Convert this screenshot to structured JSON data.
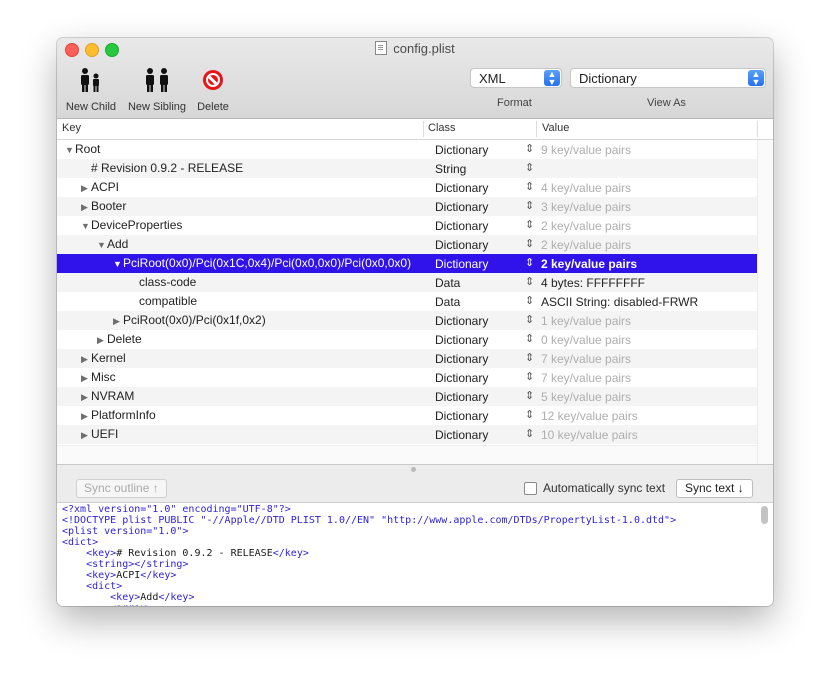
{
  "window": {
    "title": "config.plist"
  },
  "toolbar": {
    "new_child": "New Child",
    "new_sibling": "New Sibling",
    "delete": "Delete",
    "format": {
      "value": "XML",
      "label": "Format"
    },
    "view_as": {
      "value": "Dictionary",
      "label": "View As"
    }
  },
  "table": {
    "headers": {
      "key": "Key",
      "class": "Class",
      "value": "Value"
    },
    "rows": [
      {
        "indent": 0,
        "disclosure": "▼",
        "key": "Root",
        "class": "Dictionary",
        "value": "9 key/value pairs",
        "dim": true
      },
      {
        "indent": 1,
        "disclosure": "",
        "key": "# Revision 0.9.2 - RELEASE",
        "class": "String",
        "value": "",
        "dim": false
      },
      {
        "indent": 1,
        "disclosure": "▶",
        "key": "ACPI",
        "class": "Dictionary",
        "value": "4 key/value pairs",
        "dim": true
      },
      {
        "indent": 1,
        "disclosure": "▶",
        "key": "Booter",
        "class": "Dictionary",
        "value": "3 key/value pairs",
        "dim": true
      },
      {
        "indent": 1,
        "disclosure": "▼",
        "key": "DeviceProperties",
        "class": "Dictionary",
        "value": "2 key/value pairs",
        "dim": true
      },
      {
        "indent": 2,
        "disclosure": "▼",
        "key": "Add",
        "class": "Dictionary",
        "value": "2 key/value pairs",
        "dim": true
      },
      {
        "indent": 3,
        "disclosure": "▼",
        "key": "PciRoot(0x0)/Pci(0x1C,0x4)/Pci(0x0,0x0)/Pci(0x0,0x0)",
        "class": "Dictionary",
        "value": "2 key/value pairs",
        "dim": false,
        "selected": true
      },
      {
        "indent": 4,
        "disclosure": "",
        "key": "class-code",
        "class": "Data",
        "value": "4 bytes: FFFFFFFF",
        "dim": false
      },
      {
        "indent": 4,
        "disclosure": "",
        "key": "compatible",
        "class": "Data",
        "value": "ASCII String: disabled-FRWR",
        "dim": false
      },
      {
        "indent": 3,
        "disclosure": "▶",
        "key": "PciRoot(0x0)/Pci(0x1f,0x2)",
        "class": "Dictionary",
        "value": "1 key/value pairs",
        "dim": true
      },
      {
        "indent": 2,
        "disclosure": "▶",
        "key": "Delete",
        "class": "Dictionary",
        "value": "0 key/value pairs",
        "dim": true
      },
      {
        "indent": 1,
        "disclosure": "▶",
        "key": "Kernel",
        "class": "Dictionary",
        "value": "7 key/value pairs",
        "dim": true
      },
      {
        "indent": 1,
        "disclosure": "▶",
        "key": "Misc",
        "class": "Dictionary",
        "value": "7 key/value pairs",
        "dim": true
      },
      {
        "indent": 1,
        "disclosure": "▶",
        "key": "NVRAM",
        "class": "Dictionary",
        "value": "5 key/value pairs",
        "dim": true
      },
      {
        "indent": 1,
        "disclosure": "▶",
        "key": "PlatformInfo",
        "class": "Dictionary",
        "value": "12 key/value pairs",
        "dim": true
      },
      {
        "indent": 1,
        "disclosure": "▶",
        "key": "UEFI",
        "class": "Dictionary",
        "value": "10 key/value pairs",
        "dim": true
      }
    ]
  },
  "sync_bar": {
    "sync_outline": "Sync outline ↑",
    "auto_sync": "Automatically sync text",
    "sync_text": "Sync text ↓"
  },
  "xml_text": {
    "lines": [
      [
        {
          "c": "pi",
          "s": "<?xml version=\"1.0\" encoding=\"UTF-8\"?>"
        }
      ],
      [
        {
          "c": "pi",
          "s": "<!DOCTYPE plist PUBLIC \"-//Apple//DTD PLIST 1.0//EN\" \"http://www.apple.com/DTDs/PropertyList-1.0.dtd\">"
        }
      ],
      [
        {
          "c": "pi",
          "s": "<plist version=\"1.0\">"
        }
      ],
      [
        {
          "c": "pi",
          "s": "<dict>"
        }
      ],
      [
        {
          "c": "pi",
          "s": "    <key>"
        },
        {
          "c": "t",
          "s": "# Revision 0.9.2 - RELEASE"
        },
        {
          "c": "pi",
          "s": "</key>"
        }
      ],
      [
        {
          "c": "pi",
          "s": "    <string></string>"
        }
      ],
      [
        {
          "c": "pi",
          "s": "    <key>"
        },
        {
          "c": "t",
          "s": "ACPI"
        },
        {
          "c": "pi",
          "s": "</key>"
        }
      ],
      [
        {
          "c": "pi",
          "s": "    <dict>"
        }
      ],
      [
        {
          "c": "pi",
          "s": "        <key>"
        },
        {
          "c": "t",
          "s": "Add"
        },
        {
          "c": "pi",
          "s": "</key>"
        }
      ],
      [
        {
          "c": "pi",
          "s": "        <array>"
        }
      ]
    ]
  }
}
